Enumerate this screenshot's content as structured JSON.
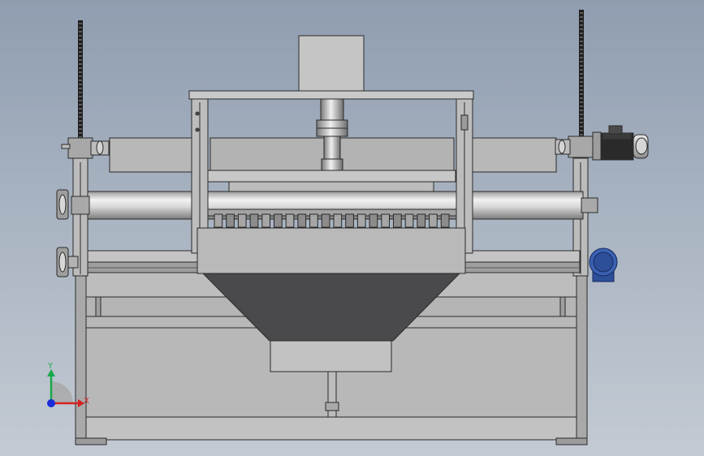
{
  "viewport": {
    "background_top": "#8f9db0",
    "background_bottom": "#c3cad3"
  },
  "colors": {
    "steel_light": "#c9c9c9",
    "steel_mid": "#b0b0b0",
    "steel_dark": "#8a8a8a",
    "outline": "#2a2a2a",
    "hopper": "#4a4a4c",
    "chain": "#1e1e1e",
    "motor_blue": "#2d4f9a",
    "axis_x": "#d62020",
    "axis_y": "#18a84a",
    "axis_z": "#1a2bd8"
  },
  "triad": {
    "x_label": "X",
    "y_label": "Y"
  },
  "model": {
    "comb_teeth": 20,
    "icons": [
      "motor-icon",
      "gearbox-icon",
      "sprocket-icon",
      "coordinate-triad-icon"
    ]
  }
}
